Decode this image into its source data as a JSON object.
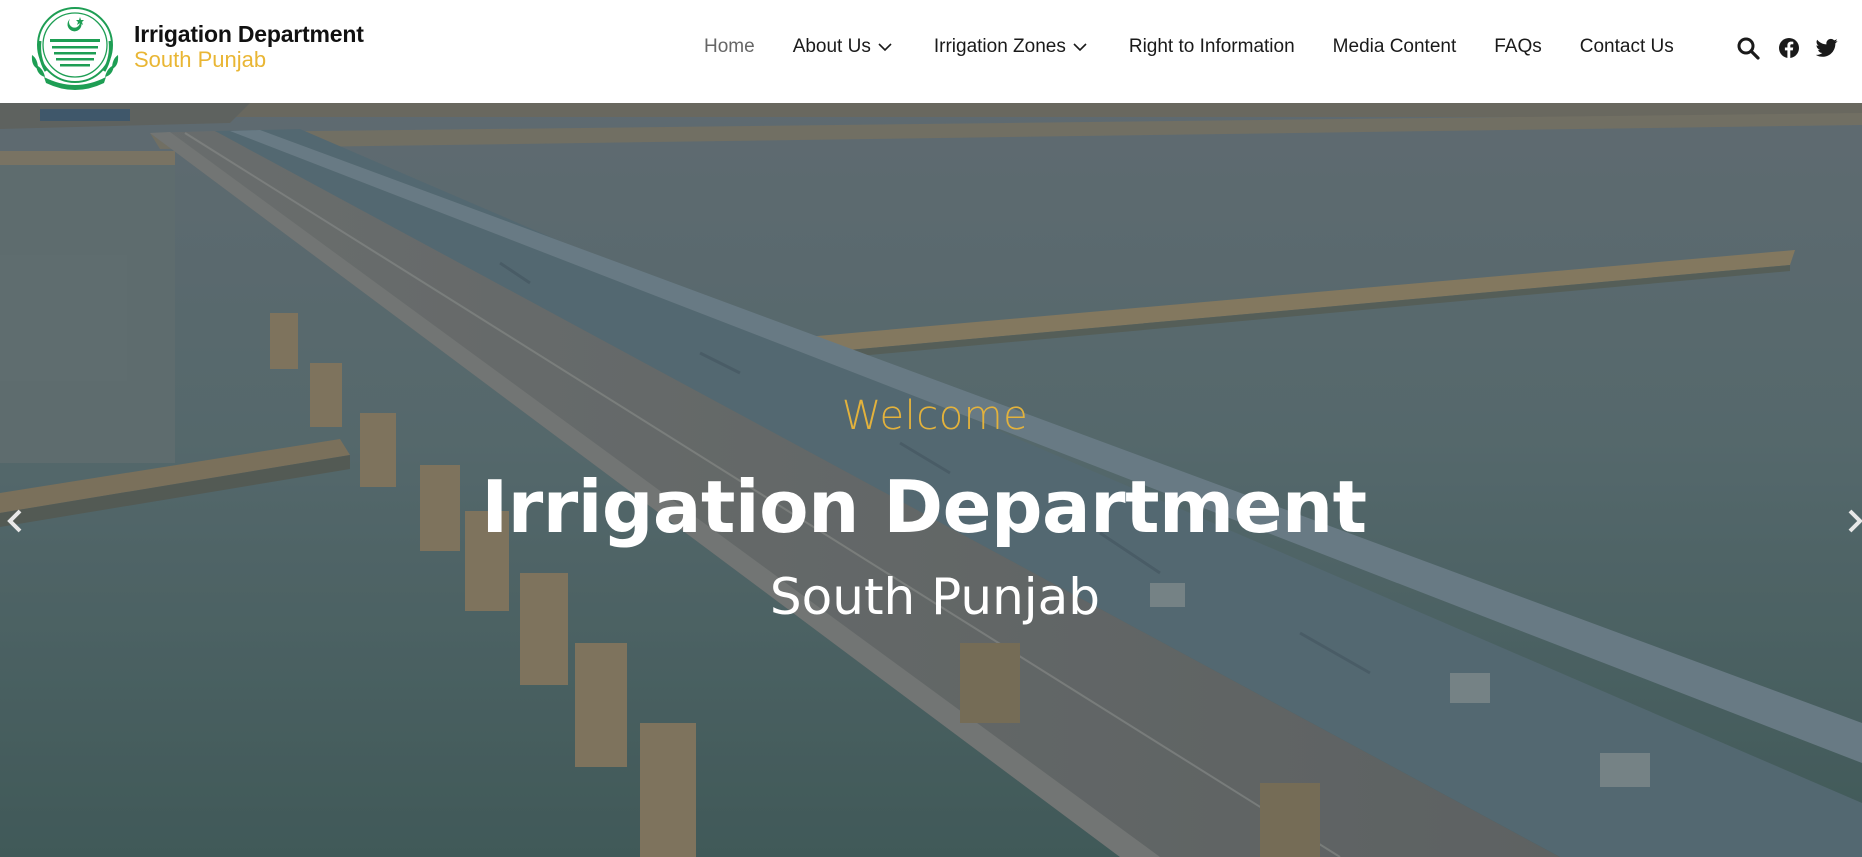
{
  "site": {
    "title": "Irrigation Department",
    "subtitle": "South Punjab"
  },
  "nav": {
    "items": [
      {
        "label": "Home",
        "active": true,
        "dropdown": false
      },
      {
        "label": "About Us",
        "active": false,
        "dropdown": true
      },
      {
        "label": "Irrigation Zones",
        "active": false,
        "dropdown": true
      },
      {
        "label": "Right to Information",
        "active": false,
        "dropdown": false
      },
      {
        "label": "Media Content",
        "active": false,
        "dropdown": false
      },
      {
        "label": "FAQs",
        "active": false,
        "dropdown": false
      },
      {
        "label": "Contact Us",
        "active": false,
        "dropdown": false
      }
    ],
    "icons": [
      "search-icon",
      "facebook-icon",
      "twitter-icon"
    ]
  },
  "hero": {
    "eyebrow": "Welcome",
    "title": "Irrigation Department",
    "subtitle": "South Punjab",
    "image": "aerial-barrage-bridge-over-river"
  },
  "colors": {
    "accent": "#e9b634",
    "emblem_green": "#1e9e54",
    "nav_text": "#1a1a1a",
    "nav_active": "#666666"
  }
}
